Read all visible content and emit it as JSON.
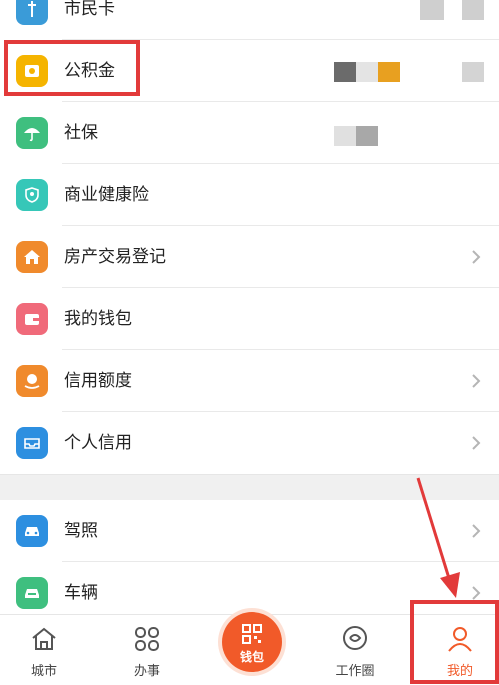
{
  "list": {
    "items": [
      {
        "label": "市民卡",
        "icon": "citizen-card-icon",
        "color": "#3a9bd8"
      },
      {
        "label": "公积金",
        "icon": "housing-fund-icon",
        "color": "#f5b400"
      },
      {
        "label": "社保",
        "icon": "umbrella-icon",
        "color": "#3fbf7f"
      },
      {
        "label": "商业健康险",
        "icon": "health-insurance-icon",
        "color": "#36c7b8"
      },
      {
        "label": "房产交易登记",
        "icon": "house-icon",
        "color": "#f08a2c"
      },
      {
        "label": "我的钱包",
        "icon": "wallet-icon",
        "color": "#f06a7a"
      },
      {
        "label": "信用额度",
        "icon": "credit-limit-icon",
        "color": "#f08a2c"
      },
      {
        "label": "个人信用",
        "icon": "inbox-icon",
        "color": "#2d8fe0"
      },
      {
        "label": "驾照",
        "icon": "car-icon",
        "color": "#2d8fe0"
      },
      {
        "label": "车辆",
        "icon": "vehicle-icon",
        "color": "#3fbf7f"
      }
    ]
  },
  "tabbar": {
    "tabs": [
      {
        "label": "城市",
        "icon": "home-icon"
      },
      {
        "label": "办事",
        "icon": "grid-icon"
      },
      {
        "label": "钱包",
        "icon": "qr-wallet-icon"
      },
      {
        "label": "工作圈",
        "icon": "chat-circle-icon"
      },
      {
        "label": "我的",
        "icon": "person-icon",
        "active": true
      }
    ]
  },
  "colors": {
    "highlight": "#e23a3a",
    "active_tab": "#f15a29",
    "wallet_button": "#f15a29"
  }
}
